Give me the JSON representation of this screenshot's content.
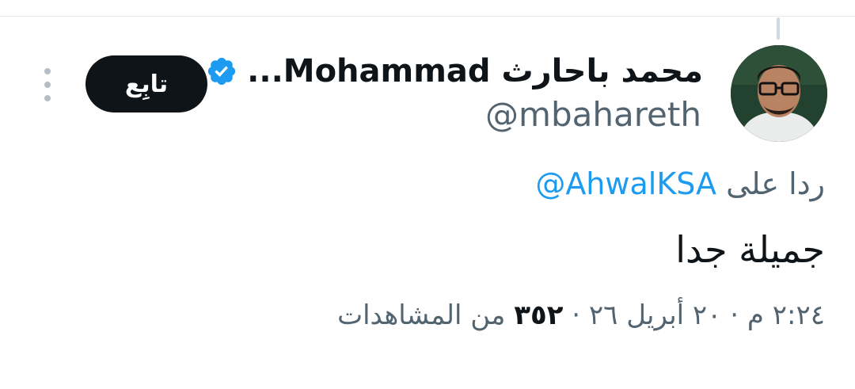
{
  "tweet": {
    "author": {
      "display_name": "محمد باحارث Mohammad...",
      "handle": "@mbahareth",
      "verified": true,
      "avatar_icon": "profile-photo"
    },
    "follow_label": "تابِع",
    "more_icon": "more-vertical-icon",
    "reply": {
      "prefix": "ردا على",
      "mention": "@AhwalKSA"
    },
    "text": "جميلة جدا",
    "meta": {
      "time": "٢:٢٤ م",
      "separator1": "·",
      "date": "٢٠ أبريل ٢٦",
      "separator2": "·",
      "views_count": "٣٥٢",
      "views_label": "من المشاهدات"
    }
  },
  "colors": {
    "text_primary": "#0f1419",
    "text_secondary": "#536471",
    "link": "#1d9bf0",
    "verified": "#1d9bf0",
    "follow_button_bg": "#0f1419",
    "divider": "#e6ecf0"
  }
}
